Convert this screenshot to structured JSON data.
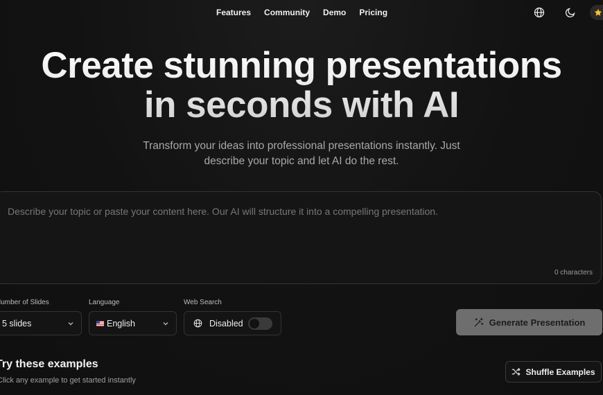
{
  "nav": {
    "links": [
      "Features",
      "Community",
      "Demo",
      "Pricing"
    ],
    "icons": [
      "globe-icon",
      "moon-icon",
      "star-icon"
    ]
  },
  "hero": {
    "title_line1": "Create stunning presentations",
    "title_line2": "in seconds with AI",
    "subtitle_line1": "Transform your ideas into professional presentations instantly. Just",
    "subtitle_line2": "describe your topic and let AI do the rest."
  },
  "prompt": {
    "placeholder": "Describe your topic or paste your content here. Our AI will structure it into a compelling presentation.",
    "value": "",
    "char_count": "0 characters"
  },
  "controls": {
    "slides_label": "Number of Slides",
    "slides_value": "5 slides",
    "language_label": "Language",
    "language_value": "English",
    "web_search_label": "Web Search",
    "web_search_value": "Disabled",
    "web_search_enabled": false
  },
  "actions": {
    "generate_label": "Generate Presentation",
    "shuffle_label": "Shuffle Examples"
  },
  "examples": {
    "title": "Try these examples",
    "subtitle": "Click any example to get started instantly"
  },
  "colors": {
    "background": "#121212",
    "generate_button": "#6e6e6e",
    "star": "#f5c518"
  }
}
